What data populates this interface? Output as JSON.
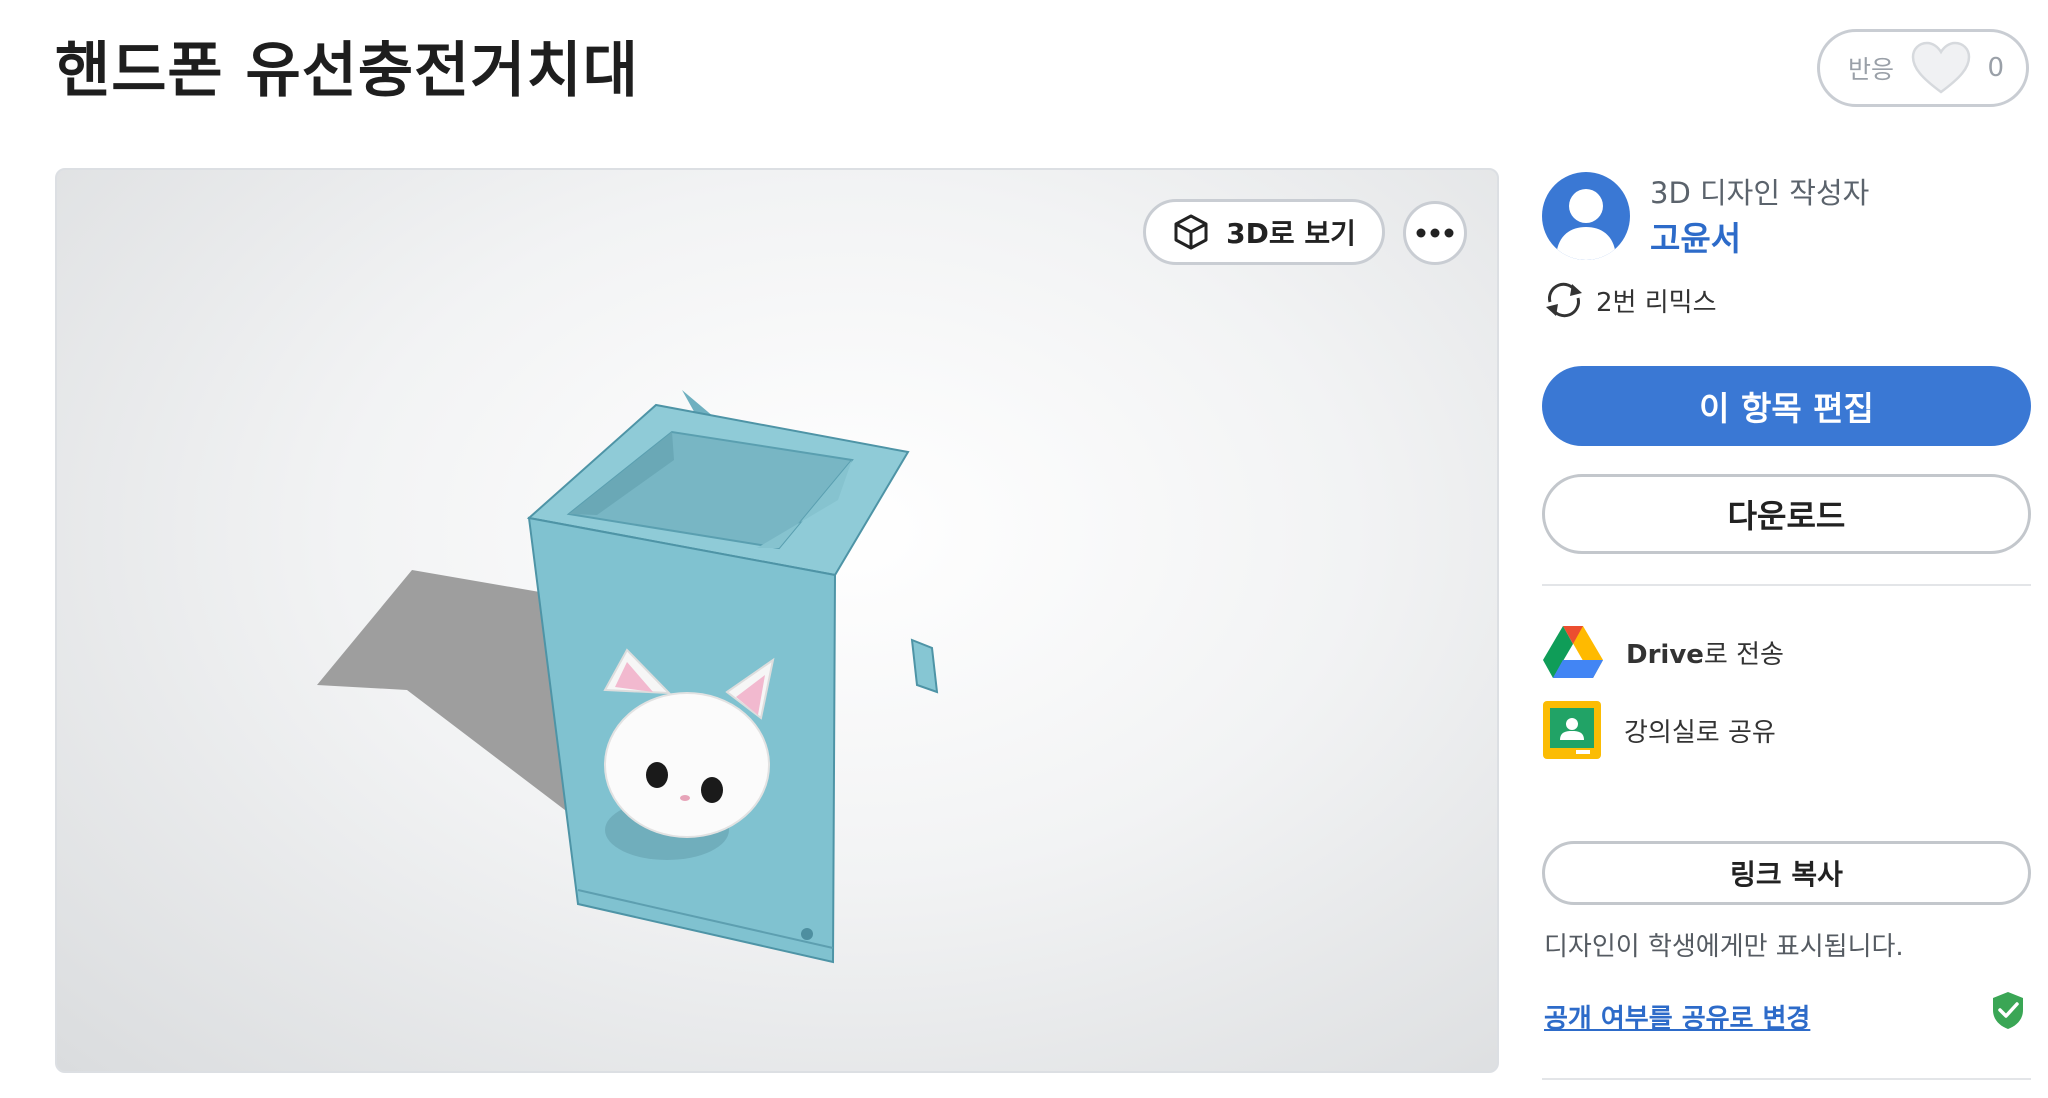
{
  "design": {
    "title": "핸드폰 유선충전거치대"
  },
  "reactions": {
    "label": "반응",
    "count": "0"
  },
  "viewer": {
    "view3d_label": "3D로 보기"
  },
  "author": {
    "role": "3D 디자인 작성자",
    "name": "고윤서"
  },
  "remix": {
    "text": "2번 리믹스"
  },
  "actions": {
    "edit_label": "이 항목 편집",
    "download_label": "다운로드"
  },
  "share": {
    "drive_brand": "Drive",
    "drive_suffix": "로 전송",
    "classroom_label": "강의실로 공유",
    "copy_link_label": "링크 복사",
    "visibility_note": "디자인이 학생에게만 표시됩니다.",
    "make_public_label": "공개 여부를 공유로 변경"
  },
  "colors": {
    "accent": "#3a78d4",
    "model": "#7fc0cf",
    "success": "#3aa655"
  },
  "icons": [
    "heart-icon",
    "cube-icon",
    "more-icon",
    "user-avatar-icon",
    "remix-icon",
    "google-drive-icon",
    "classroom-icon",
    "shield-check-icon"
  ]
}
